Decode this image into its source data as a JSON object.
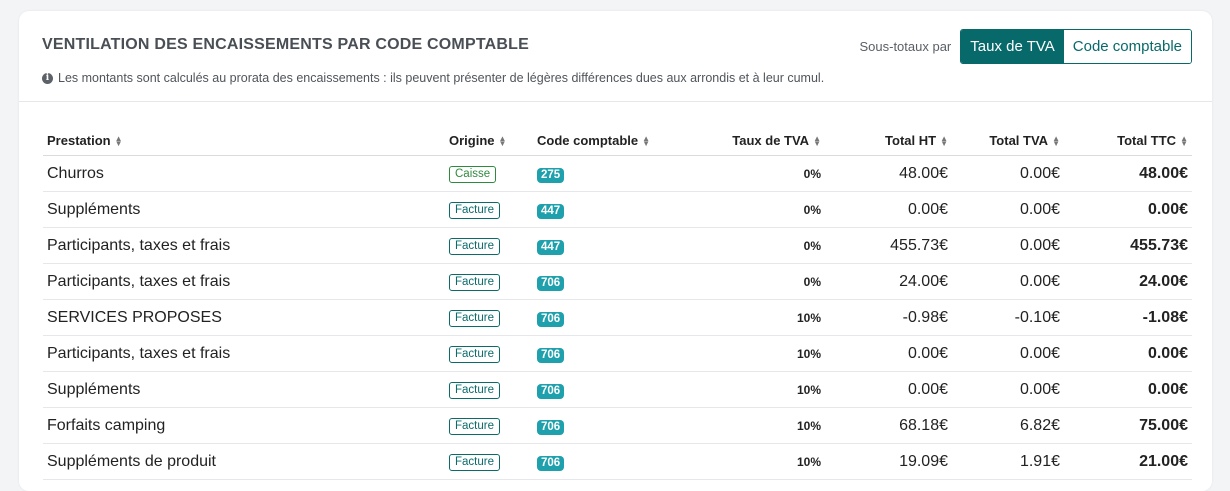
{
  "header": {
    "title": "VENTILATION DES ENCAISSEMENTS PAR CODE COMPTABLE",
    "note": "Les montants sont calculés au prorata des encaissements : ils peuvent présenter de légères différences dues aux arrondis et à leur cumul.",
    "info_icon": "info-circle-icon",
    "subtotals_label": "Sous-totaux par",
    "subtotals_options": [
      "Taux de TVA",
      "Code comptable"
    ],
    "subtotals_selected": "Taux de TVA"
  },
  "colors": {
    "accent": "#08696a",
    "code_badge": "#1fa0ad",
    "caisse_badge": "#2e8b3e",
    "facture_badge": "#0b6b6b"
  },
  "table": {
    "columns": [
      "Prestation",
      "Origine",
      "Code comptable",
      "Taux de TVA",
      "Total HT",
      "Total TVA",
      "Total TTC"
    ],
    "sort_icon": "sort-icon",
    "rows": [
      {
        "prestation": "Churros",
        "origine": "Caisse",
        "code": "275",
        "tva_rate": "0%",
        "ht": "48.00€",
        "tva": "0.00€",
        "ttc": "48.00€"
      },
      {
        "prestation": "Suppléments",
        "origine": "Facture",
        "code": "447",
        "tva_rate": "0%",
        "ht": "0.00€",
        "tva": "0.00€",
        "ttc": "0.00€"
      },
      {
        "prestation": "Participants, taxes et frais",
        "origine": "Facture",
        "code": "447",
        "tva_rate": "0%",
        "ht": "455.73€",
        "tva": "0.00€",
        "ttc": "455.73€"
      },
      {
        "prestation": "Participants, taxes et frais",
        "origine": "Facture",
        "code": "706",
        "tva_rate": "0%",
        "ht": "24.00€",
        "tva": "0.00€",
        "ttc": "24.00€"
      },
      {
        "prestation": "SERVICES PROPOSES",
        "origine": "Facture",
        "code": "706",
        "tva_rate": "10%",
        "ht": "-0.98€",
        "tva": "-0.10€",
        "ttc": "-1.08€"
      },
      {
        "prestation": "Participants, taxes et frais",
        "origine": "Facture",
        "code": "706",
        "tva_rate": "10%",
        "ht": "0.00€",
        "tva": "0.00€",
        "ttc": "0.00€"
      },
      {
        "prestation": "Suppléments",
        "origine": "Facture",
        "code": "706",
        "tva_rate": "10%",
        "ht": "0.00€",
        "tva": "0.00€",
        "ttc": "0.00€"
      },
      {
        "prestation": "Forfaits camping",
        "origine": "Facture",
        "code": "706",
        "tva_rate": "10%",
        "ht": "68.18€",
        "tva": "6.82€",
        "ttc": "75.00€"
      },
      {
        "prestation": "Suppléments de produit",
        "origine": "Facture",
        "code": "706",
        "tva_rate": "10%",
        "ht": "19.09€",
        "tva": "1.91€",
        "ttc": "21.00€"
      }
    ]
  }
}
